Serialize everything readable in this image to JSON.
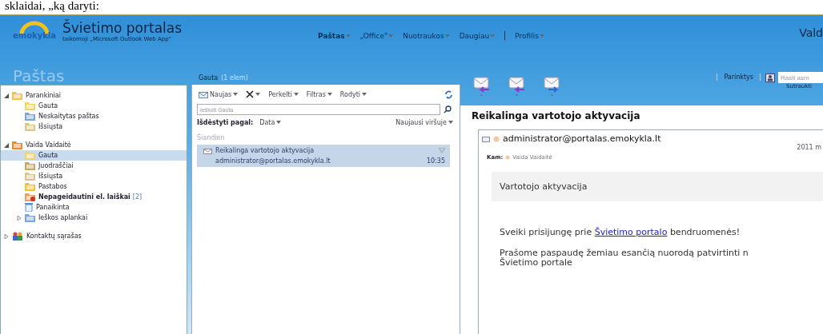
{
  "doc_text": "sklaidai, „ką daryti:",
  "header": {
    "logo_text": "emokykla",
    "title": "Švietimo portalas",
    "subtitle": "taikomoji „Microsoft Outlook Web App\"",
    "user": "Vald",
    "nav": [
      {
        "label": "Paštas",
        "selected": true
      },
      {
        "label": "„Office\"",
        "selected": false
      },
      {
        "label": "Nuotraukos",
        "selected": false
      },
      {
        "label": "Daugiau",
        "selected": false
      },
      {
        "label": "Profilis",
        "selected": false
      }
    ]
  },
  "section_title": "Paštas",
  "folder_title": "Gauta",
  "folder_count": "(1 elem)",
  "options": "Parinktys",
  "people_search": {
    "placeholder": "Rasti asm"
  },
  "folders": [
    {
      "label": "Parankiniai",
      "kind": "favorites",
      "expanded": true,
      "selected": false,
      "unread": false,
      "children": [
        {
          "label": "Gauta",
          "kind": "inbox",
          "selected": false,
          "unread": false
        },
        {
          "label": "Neskaitytas paštas",
          "kind": "search",
          "selected": false,
          "unread": false
        },
        {
          "label": "Išsiųsta",
          "kind": "sent",
          "selected": false,
          "unread": false
        }
      ]
    },
    {
      "label": "Vaida Vaidaitė",
      "kind": "mailbox",
      "expanded": true,
      "selected": false,
      "unread": false,
      "children": [
        {
          "label": "Gauta",
          "kind": "inbox",
          "selected": true,
          "unread": false
        },
        {
          "label": "Juodraščiai",
          "kind": "drafts",
          "selected": false,
          "unread": false
        },
        {
          "label": "Išsiųsta",
          "kind": "sent",
          "selected": false,
          "unread": false
        },
        {
          "label": "Pastabos",
          "kind": "notes",
          "selected": false,
          "unread": false
        },
        {
          "label": "Nepageidautini el. laiškai",
          "kind": "junk",
          "selected": false,
          "unread": true,
          "count": "[2]"
        },
        {
          "label": "Panaikinta",
          "kind": "deleted",
          "selected": false,
          "unread": false
        },
        {
          "label": "Ieškos aplankai",
          "kind": "search",
          "expanded": false,
          "selected": false,
          "unread": false
        }
      ]
    },
    {
      "label": "Kontaktų sąrašas",
      "kind": "contacts",
      "expanded": false,
      "selected": false,
      "unread": false
    }
  ],
  "toolbar": [
    {
      "label": "Naujas",
      "kind": "new"
    },
    {
      "kind": "delete"
    },
    {
      "label": "Perkelti",
      "kind": "menu"
    },
    {
      "label": "Filtras",
      "kind": "menu"
    },
    {
      "label": "Rodyti",
      "kind": "menu"
    },
    {
      "kind": "refresh"
    }
  ],
  "search": {
    "placeholder": "Ieškoti Gauta"
  },
  "sort": {
    "label": "Išdėstyti pagal:",
    "value": "Data",
    "order": "Naujausi viršuje"
  },
  "group": "Šiandien",
  "messages": [
    {
      "subject": "Reikalinga vartotojo aktyvacija",
      "sender": "administrator@portalas.emokykla.lt",
      "time": "10:35",
      "selected": true
    }
  ],
  "reading": {
    "collapse": "Sutraukti",
    "subject": "Reikalinga vartotojo aktyvacija",
    "sender": "administrator@portalas.emokykla.lt",
    "date": "2011 m",
    "to_label": "Kam:",
    "to": "Vaida Vaidaitė",
    "heading": "Vartotojo aktyvacija",
    "greeting_before": "Sveiki prisijungę prie",
    "greeting_link": "Švietimo portalo",
    "greeting_after": "bendruomenės!",
    "lines": [
      "Prašome paspaudę žemiau esančią nuorodą patvirtinti n",
      "Švietimo portale"
    ]
  }
}
